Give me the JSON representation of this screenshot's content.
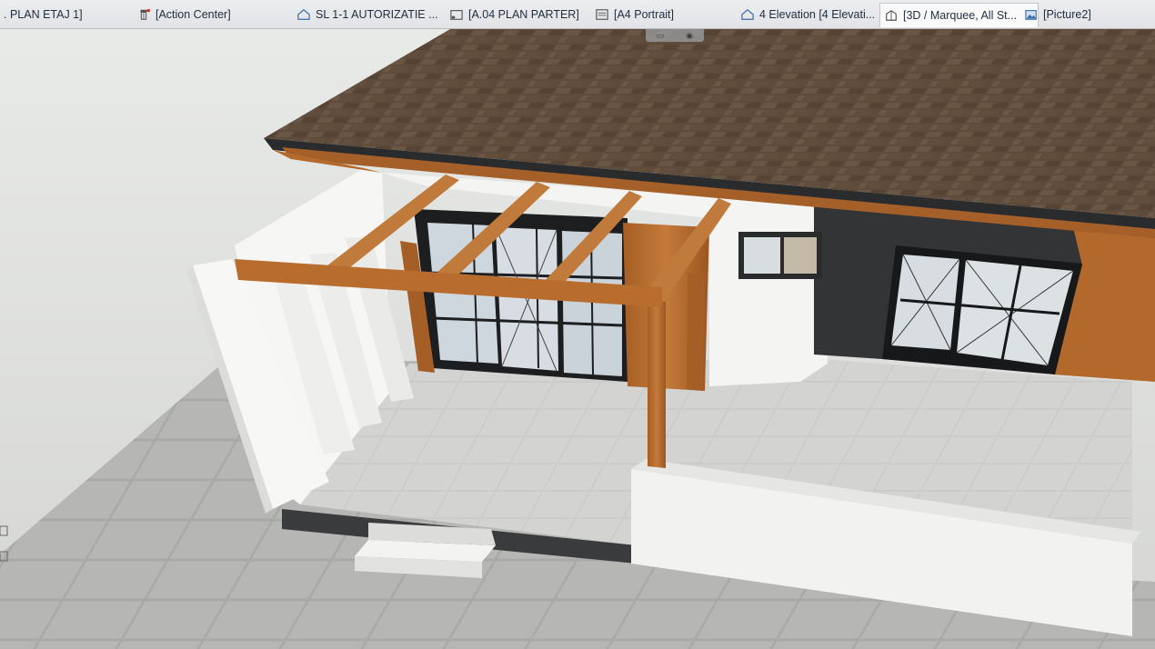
{
  "tabs": [
    {
      "label": ". PLAN ETAJ 1]",
      "icon": "floor-plan-icon",
      "active": false
    },
    {
      "label": "[Action Center]",
      "icon": "action-center-icon",
      "active": false
    },
    {
      "label": "SL  1-1 AUTORIZATIE ...",
      "icon": "section-icon",
      "active": false
    },
    {
      "label": "[A.04 PLAN PARTER]",
      "icon": "layout-icon",
      "active": false
    },
    {
      "label": "[A4 Portrait]",
      "icon": "layout-sheet-icon",
      "active": false
    },
    {
      "label": "4 Elevation [4 Elevati...",
      "icon": "elevation-icon",
      "active": false
    },
    {
      "label": "[3D / Marquee, All St...",
      "icon": "3d-view-icon",
      "active": true,
      "close": "×"
    },
    {
      "label": "[Picture2]",
      "icon": "picture-icon",
      "active": false
    }
  ],
  "colors": {
    "roof": "#5c4a3a",
    "wood": "#b46a2c",
    "wall_white": "#f4f4f2",
    "wall_dark": "#2f3134",
    "tile_floor": "#cfd0ce",
    "ground": "#b9bab8"
  }
}
